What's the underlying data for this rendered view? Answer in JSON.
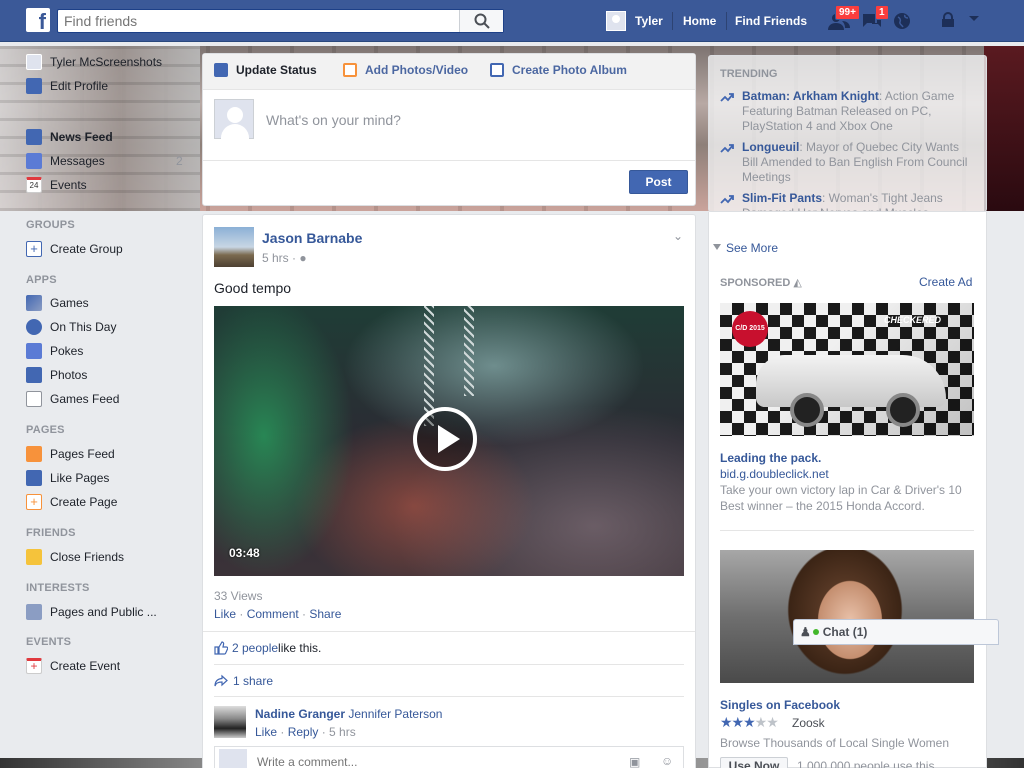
{
  "topbar": {
    "logo": "f",
    "search_placeholder": "Find friends",
    "user": "Tyler",
    "home": "Home",
    "find_friends": "Find Friends",
    "friend_requests_badge": "99+",
    "messages_badge": "1"
  },
  "leftnav": {
    "profile_name": "Tyler McScreenshots",
    "edit_profile": "Edit Profile",
    "news_feed": "News Feed",
    "messages": "Messages",
    "messages_count": "2",
    "events": "Events",
    "events_icon_num": "24",
    "groups_head": "GROUPS",
    "create_group": "Create Group",
    "apps_head": "APPS",
    "games": "Games",
    "on_this_day": "On This Day",
    "pokes": "Pokes",
    "photos": "Photos",
    "games_feed": "Games Feed",
    "pages_head": "PAGES",
    "pages_feed": "Pages Feed",
    "like_pages": "Like Pages",
    "create_page": "Create Page",
    "friends_head": "FRIENDS",
    "close_friends": "Close Friends",
    "interests_head": "INTERESTS",
    "pages_public": "Pages and Public ...",
    "events_head": "EVENTS",
    "create_event": "Create Event"
  },
  "composer": {
    "tab_status": "Update Status",
    "tab_photos": "Add Photos/Video",
    "tab_album": "Create Photo Album",
    "placeholder": "What's on your mind?",
    "post": "Post"
  },
  "story": {
    "author": "Jason Barnabe",
    "time": "5 hrs ·",
    "text": "Good tempo",
    "video_duration": "03:48",
    "views": "33 Views",
    "like": "Like",
    "comment": "Comment",
    "share": "Share",
    "likes_count": "2 people",
    "likes_suffix": " like this.",
    "shares": "1 share",
    "comment_author": "Nadine Granger",
    "comment_text": "Jennifer Paterson",
    "comment_like": "Like",
    "comment_reply": "Reply",
    "comment_time": "5 hrs",
    "write_placeholder": "Write a comment..."
  },
  "trending": {
    "head": "TRENDING",
    "items": [
      {
        "title": "Batman: Arkham Knight",
        "desc": ": Action Game Featuring Batman Released on PC, PlayStation 4 and Xbox One"
      },
      {
        "title": "Longueuil",
        "desc": ": Mayor of Quebec City Wants Bill Amended to Ban English From Council Meetings"
      },
      {
        "title": "Slim-Fit Pants",
        "desc": ": Woman's Tight Jeans Damaged Her Nerves and Muscles, Scientists Say"
      }
    ],
    "see_more": "See More"
  },
  "sponsored": {
    "head": "SPONSORED",
    "create_ad": "Create Ad",
    "ad1_title": "Leading the pack.",
    "ad1_domain": "bid.g.doubleclick.net",
    "ad1_desc": "Take your own victory lap in Car & Driver's 10 Best winner – the 2015 Honda Accord.",
    "ad1_logo_left": "CAR and DRIVER 2015",
    "ad1_logo_right": "CHECKERED",
    "ad2_title": "Singles on Facebook",
    "ad2_rating": 2.5,
    "ad2_brand": "Zoosk",
    "ad2_desc": "Browse Thousands of Local Single Women",
    "use_now": "Use Now",
    "use_count": "1,000,000 people use this."
  },
  "chat": {
    "label": "Chat (1)"
  },
  "colors": {
    "brand": "#3b5998",
    "link": "#365899",
    "badge": "#fa3e3e"
  }
}
